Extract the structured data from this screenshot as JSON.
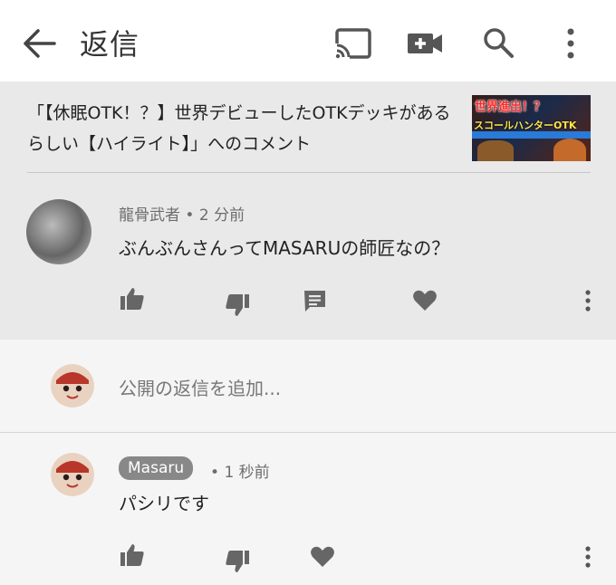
{
  "header": {
    "title": "返信",
    "icons": [
      "back-arrow-icon",
      "cast-icon",
      "video-add-icon",
      "search-icon",
      "more-vert-icon"
    ]
  },
  "video": {
    "title": "「【休眠OTK！？】世界デビューしたOTKデッキがあるらしい【ハイライト】」へのコメント",
    "thumbnail_text_1": "世界進出！？",
    "thumbnail_text_2": "スコールハンターOTK"
  },
  "comment": {
    "author": "龍骨武者",
    "time": "2 分前",
    "text": "ぶんぶんさんってMASARUの師匠なの？",
    "actions": [
      "like-icon",
      "dislike-icon",
      "reply-icon",
      "heart-icon",
      "more-vert-icon"
    ]
  },
  "reply_box": {
    "placeholder": "公開の返信を追加..."
  },
  "reply": {
    "author": "Masaru",
    "time": "1 秒前",
    "text": "パシリです",
    "actions": [
      "like-icon",
      "dislike-icon",
      "heart-icon",
      "more-vert-icon"
    ]
  },
  "colors": {
    "top_bar": "#ffffff",
    "context_bg": "#e9e9e9",
    "icon_gray": "#666666",
    "badge_bg": "#888888"
  }
}
